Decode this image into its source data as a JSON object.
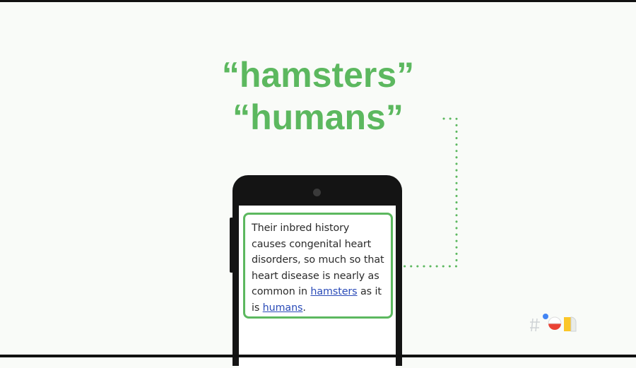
{
  "headline": {
    "line1": "“hamsters”",
    "line2": "“humans”"
  },
  "phone_screen": {
    "text_part1": "Their inbred history causes congenital heart disorders, so much so that heart disease is nearly as common in ",
    "link1": "hamsters",
    "text_part2": " as it is ",
    "link2": "humans",
    "text_part3": "."
  },
  "colors": {
    "accent_green": "#5cb85f",
    "link_blue": "#2a4bb8",
    "background": "#f9fbf8"
  },
  "logo": {
    "icon": "io-hashtag-logo-icon"
  }
}
